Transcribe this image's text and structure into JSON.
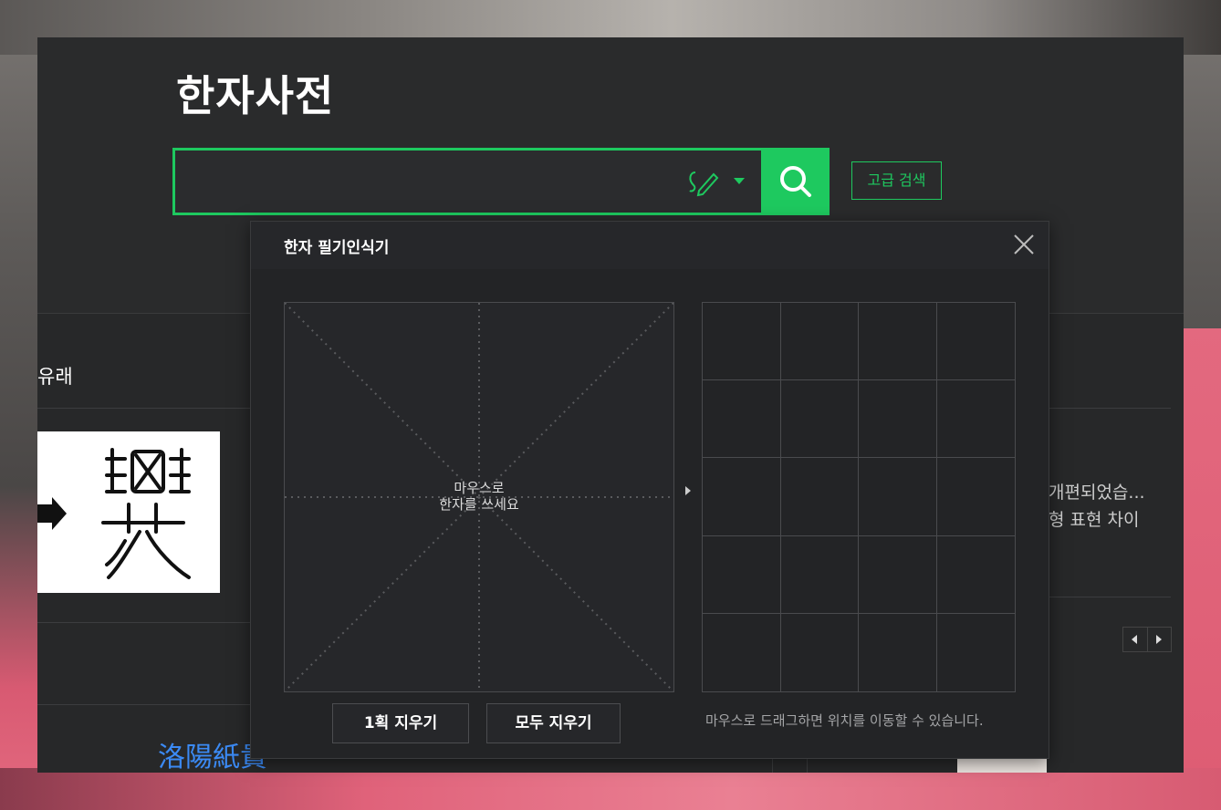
{
  "app": {
    "title": "한자사전"
  },
  "search": {
    "placeholder": "",
    "advanced_label": "고급 검색"
  },
  "background_section": {
    "left_title": "유래",
    "bottom_hanja": "洛陽紙貴",
    "bottom_tail": "",
    "bottom_link": "",
    "right_text_1": "개편되었습...",
    "right_text_2": "형 표현 차이"
  },
  "popup": {
    "title": "한자 필기인식기",
    "hint_line1": "마우스로",
    "hint_line2": "한자를 쓰세요",
    "clear_one_label": "1획 지우기",
    "clear_all_label": "모두 지우기",
    "drag_hint": "마우스로 드래그하면 위치를 이동할 수 있습니다."
  },
  "colors": {
    "accent": "#1ec95f",
    "panel": "#272829",
    "popup": "#232426",
    "link": "#3b8af4"
  },
  "icons": [
    "pen-icon",
    "caret-down-icon",
    "search-icon",
    "close-icon",
    "arrow-right-icon",
    "chevron-left-icon",
    "chevron-right-icon"
  ]
}
